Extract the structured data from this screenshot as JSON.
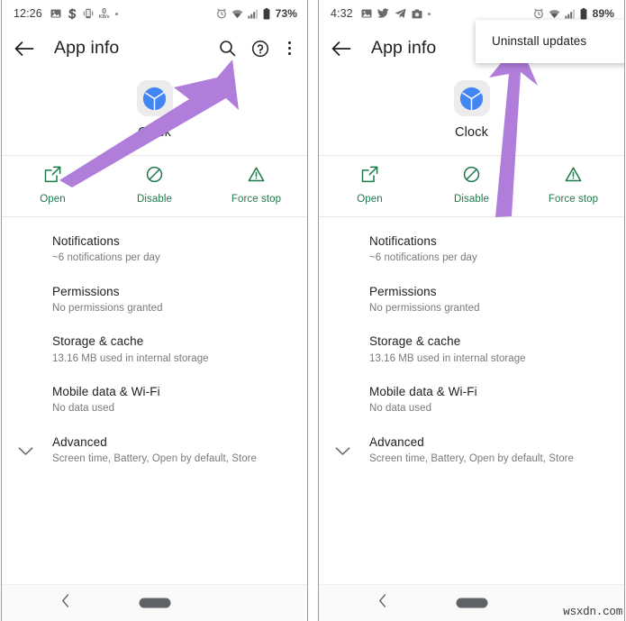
{
  "meta": {
    "watermark": "wsxdn.com",
    "accent_green": "#1b7a49",
    "arrow_purple": "#b07ddb",
    "panel_border": "#a790b5",
    "clock_icon_blue": "#4285f4"
  },
  "panels": [
    {
      "id": "left-panel",
      "status": {
        "time": "12:26",
        "left_icons": [
          "image-icon",
          "dollar-s-icon",
          "phone-vibrate-icon"
        ],
        "netspeed_value": "0",
        "netspeed_unit": "KB/s",
        "right_icons": [
          "alarm-icon",
          "wifi-icon",
          "signal-icon",
          "battery-icon"
        ],
        "battery": "73%"
      },
      "appbar": {
        "back": "back-arrow",
        "title": "App info",
        "actions": [
          "search-icon",
          "help-icon",
          "overflow-menu-icon"
        ]
      },
      "app": {
        "icon": "clock-app-icon",
        "name": "Clock"
      },
      "actions": [
        {
          "label": "Open",
          "icon": "open-external-icon"
        },
        {
          "label": "Disable",
          "icon": "disable-slash-icon"
        },
        {
          "label": "Force stop",
          "icon": "warning-triangle-icon"
        }
      ],
      "settings": [
        {
          "title": "Notifications",
          "subtitle": "~6 notifications per day",
          "chevron": false
        },
        {
          "title": "Permissions",
          "subtitle": "No permissions granted",
          "chevron": false
        },
        {
          "title": "Storage & cache",
          "subtitle": "13.16 MB used in internal storage",
          "chevron": false
        },
        {
          "title": "Mobile data & Wi-Fi",
          "subtitle": "No data used",
          "chevron": false
        },
        {
          "title": "Advanced",
          "subtitle": "Screen time, Battery, Open by default, Store",
          "chevron": true
        }
      ],
      "nav": {
        "back": "nav-back-icon",
        "home": "nav-home-pill"
      },
      "popup": null,
      "arrow": "points-up-right-to-overflow-menu"
    },
    {
      "id": "right-panel",
      "status": {
        "time": "4:32",
        "left_icons": [
          "image-icon",
          "twitter-icon",
          "telegram-icon",
          "camera-icon"
        ],
        "netspeed_value": "",
        "netspeed_unit": "",
        "right_icons": [
          "alarm-icon",
          "wifi-icon",
          "signal-icon",
          "battery-icon"
        ],
        "battery": "89%"
      },
      "appbar": {
        "back": "back-arrow",
        "title": "App info",
        "actions": []
      },
      "app": {
        "icon": "clock-app-icon",
        "name": "Clock"
      },
      "actions": [
        {
          "label": "Open",
          "icon": "open-external-icon"
        },
        {
          "label": "Disable",
          "icon": "disable-slash-icon"
        },
        {
          "label": "Force stop",
          "icon": "warning-triangle-icon"
        }
      ],
      "settings": [
        {
          "title": "Notifications",
          "subtitle": "~6 notifications per day",
          "chevron": false
        },
        {
          "title": "Permissions",
          "subtitle": "No permissions granted",
          "chevron": false
        },
        {
          "title": "Storage & cache",
          "subtitle": "13.16 MB used in internal storage",
          "chevron": false
        },
        {
          "title": "Mobile data & Wi-Fi",
          "subtitle": "No data used",
          "chevron": false
        },
        {
          "title": "Advanced",
          "subtitle": "Screen time, Battery, Open by default, Store",
          "chevron": true
        }
      ],
      "nav": {
        "back": "nav-back-icon",
        "home": "nav-home-pill"
      },
      "popup": {
        "items": [
          "Uninstall updates"
        ]
      },
      "arrow": "points-up-to-uninstall-updates"
    }
  ]
}
